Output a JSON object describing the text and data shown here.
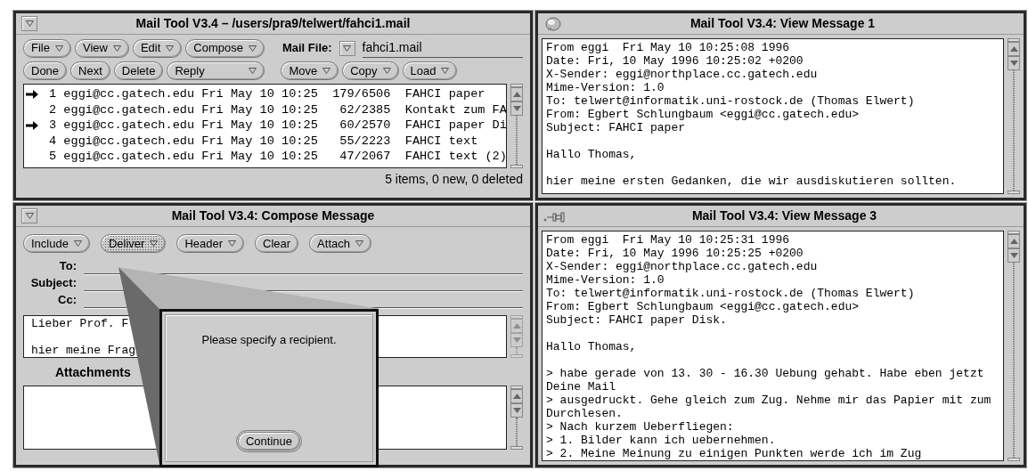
{
  "mail_window": {
    "title": "Mail Tool V3.4 – /users/pra9/telwert/fahci1.mail",
    "menu_buttons": [
      {
        "label": "File",
        "menu": true
      },
      {
        "label": "View",
        "menu": true
      },
      {
        "label": "Edit",
        "menu": true
      },
      {
        "label": "Compose",
        "menu": true
      }
    ],
    "mail_file": {
      "label": "Mail File:",
      "value": "fahci1.mail"
    },
    "action_buttons": [
      {
        "label": "Done",
        "menu": false
      },
      {
        "label": "Next",
        "menu": false
      },
      {
        "label": "Delete",
        "menu": false
      },
      {
        "label": "Reply",
        "menu": true
      },
      {
        "label": "Move",
        "menu": true
      },
      {
        "label": "Copy",
        "menu": true
      },
      {
        "label": "Load",
        "menu": true
      }
    ],
    "messages": [
      {
        "marked": true,
        "line": "1 eggi@cc.gatech.edu Fri May 10 10:25  179/6506  FAHCI paper"
      },
      {
        "marked": false,
        "line": "2 eggi@cc.gatech.edu Fri May 10 10:25   62/2385  Kontakt zum FA"
      },
      {
        "marked": true,
        "line": "3 eggi@cc.gatech.edu Fri May 10 10:25   60/2570  FAHCI paper Di"
      },
      {
        "marked": false,
        "line": "4 eggi@cc.gatech.edu Fri May 10 10:25   55/2223  FAHCI text"
      },
      {
        "marked": false,
        "line": "5 eggi@cc.gatech.edu Fri May 10 10:25   47/2067  FAHCI text (2)"
      }
    ],
    "status": "5 items, 0 new, 0 deleted"
  },
  "view_windows": [
    {
      "title": "Mail Tool V3.4: View Message 1",
      "pinned": false,
      "blocks": [
        [
          "From eggi  Fri May 10 10:25:08 1996",
          "Date: Fri, 10 May 1996 10:25:02 +0200",
          "X-Sender: eggi@northplace.cc.gatech.edu",
          "Mime-Version: 1.0",
          "To: telwert@informatik.uni-rostock.de (Thomas Elwert)",
          "From: Egbert Schlungbaum <eggi@cc.gatech.edu>",
          "Subject: FAHCI paper"
        ],
        [
          "Hallo Thomas,"
        ],
        [
          "hier meine ersten Gedanken, die wir ausdiskutieren sollten."
        ]
      ]
    },
    {
      "title": "Mail Tool V3.4: View Message 3",
      "pinned": true,
      "blocks": [
        [
          "From eggi  Fri May 10 10:25:31 1996",
          "Date: Fri, 10 May 1996 10:25:25 +0200",
          "X-Sender: eggi@northplace.cc.gatech.edu",
          "Mime-Version: 1.0",
          "To: telwert@informatik.uni-rostock.de (Thomas Elwert)",
          "From: Egbert Schlungbaum <eggi@cc.gatech.edu>",
          "Subject: FAHCI paper Disk."
        ],
        [
          "Hallo Thomas,"
        ],
        [
          "> habe gerade von 13. 30 - 16.30 Uebung gehabt. Habe eben jetzt",
          "Deine Mail",
          "> ausgedruckt. Gehe gleich zum Zug. Nehme mir das Papier mit zum",
          "Durchlesen.",
          "> Nach kurzem Ueberfliegen:",
          "> 1. Bilder kann ich uebernehmen.",
          "> 2. Meine Meinung zu einigen Punkten werde ich im Zug"
        ]
      ]
    }
  ],
  "compose_window": {
    "title": "Mail Tool V3.4: Compose Message",
    "buttons": [
      {
        "label": "Include",
        "menu": true,
        "busy": false
      },
      {
        "label": "Deliver",
        "menu": true,
        "busy": true
      },
      {
        "label": "Header",
        "menu": true,
        "busy": false
      },
      {
        "label": "Clear",
        "menu": false,
        "busy": false
      },
      {
        "label": "Attach",
        "menu": true,
        "busy": false
      }
    ],
    "fields": [
      {
        "label": "To:"
      },
      {
        "label": "Subject:"
      },
      {
        "label": "Cc:"
      }
    ],
    "body_blocks": [
      [
        "Lieber Prof. F"
      ],
      [
        "hier meine Frag"
      ]
    ],
    "attachments_label": "Attachments",
    "dialog": {
      "message": "Please specify a recipient.",
      "button": "Continue"
    }
  }
}
